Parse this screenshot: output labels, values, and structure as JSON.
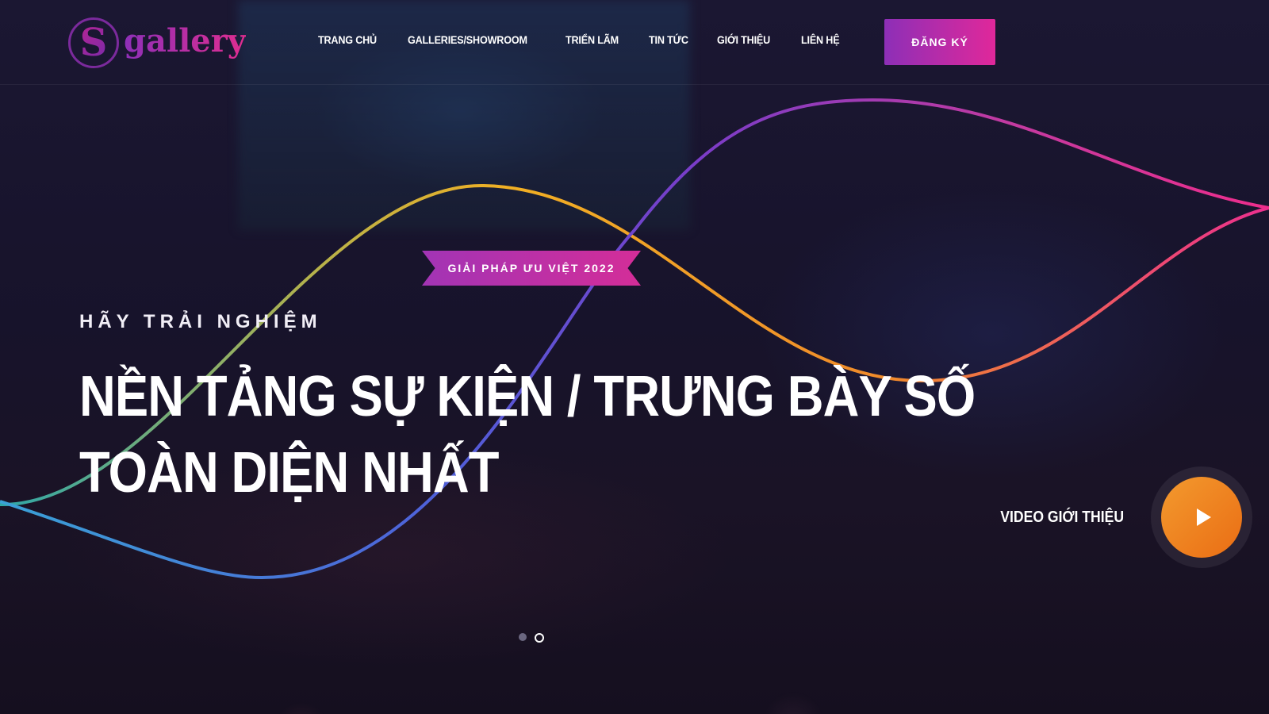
{
  "brand": {
    "logo_letter": "S",
    "logo_text": "gallery"
  },
  "nav": {
    "items": [
      {
        "label": "TRANG CHỦ"
      },
      {
        "label": "GALLERIES/SHOWROOM"
      },
      {
        "label": "TRIỂN LÃM"
      },
      {
        "label": "TIN TỨC"
      },
      {
        "label": "GIỚI THIỆU"
      },
      {
        "label": "LIÊN HỆ"
      }
    ],
    "register_label": "ĐĂNG KÝ"
  },
  "hero": {
    "ribbon": "GIẢI PHÁP ƯU VIỆT 2022",
    "eyebrow": "HÃY TRẢI NGHIỆM",
    "headline_line1": "NỀN TẢNG SỰ KIỆN / TRƯNG BÀY SỐ",
    "headline_line2": "TOÀN DIỆN NHẤT",
    "video_label": "VIDEO GIỚI THIỆU",
    "play_icon": "play-icon"
  },
  "slider": {
    "slide_count": 2,
    "active_index": 1
  },
  "colors": {
    "accent_purple": "#8d2fb7",
    "accent_pink": "#e0289a",
    "accent_orange": "#ea6d14",
    "background": "#161228"
  }
}
